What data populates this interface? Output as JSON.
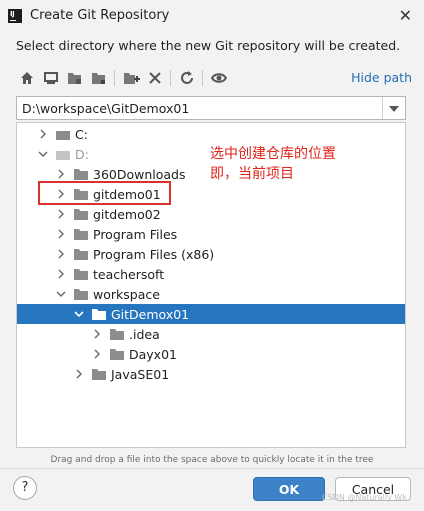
{
  "window": {
    "title": "Create Git Repository"
  },
  "dialog": {
    "subtitle": "Select directory where the new Git repository will be created.",
    "hide_path": "Hide path",
    "path_value": "D:\\workspace\\GitDemox01",
    "hint": "Drag and drop a file into the space above to quickly locate it in the tree",
    "ok_label": "OK",
    "cancel_label": "Cancel",
    "help_label": "?"
  },
  "toolbar": {
    "icons": [
      "home-icon",
      "desktop-icon",
      "project-folder-icon",
      "module-folder-icon",
      "new-folder-icon",
      "delete-icon",
      "refresh-icon",
      "show-hidden-icon"
    ]
  },
  "tree": {
    "items": [
      {
        "label": "C:",
        "level": 0,
        "state": "collapsed",
        "type": "drive",
        "dim": false
      },
      {
        "label": "D:",
        "level": 0,
        "state": "expanded",
        "type": "drive",
        "dim": true
      },
      {
        "label": "360Downloads",
        "level": 1,
        "state": "collapsed",
        "type": "folder"
      },
      {
        "label": "gitdemo01",
        "level": 1,
        "state": "collapsed",
        "type": "folder"
      },
      {
        "label": "gitdemo02",
        "level": 1,
        "state": "collapsed",
        "type": "folder"
      },
      {
        "label": "Program Files",
        "level": 1,
        "state": "collapsed",
        "type": "folder"
      },
      {
        "label": "Program Files (x86)",
        "level": 1,
        "state": "collapsed",
        "type": "folder"
      },
      {
        "label": "teachersoft",
        "level": 1,
        "state": "collapsed",
        "type": "folder"
      },
      {
        "label": "workspace",
        "level": 1,
        "state": "expanded",
        "type": "folder"
      },
      {
        "label": "GitDemox01",
        "level": 2,
        "state": "expanded",
        "type": "folder",
        "selected": true
      },
      {
        "label": ".idea",
        "level": 3,
        "state": "collapsed",
        "type": "folder"
      },
      {
        "label": "Dayx01",
        "level": 3,
        "state": "collapsed",
        "type": "folder"
      },
      {
        "label": "JavaSE01",
        "level": 2,
        "state": "collapsed",
        "type": "folder"
      }
    ]
  },
  "annotation": {
    "line1": "选中创建仓库的位置",
    "line2": "即，当前项目"
  },
  "watermark": "CSDN @Naturally Wk",
  "colors": {
    "selection": "#2675bf",
    "link": "#2470b3",
    "ok_button": "#3c82c8",
    "annotation": "#e0241b",
    "folder": "#8c8c8c"
  }
}
